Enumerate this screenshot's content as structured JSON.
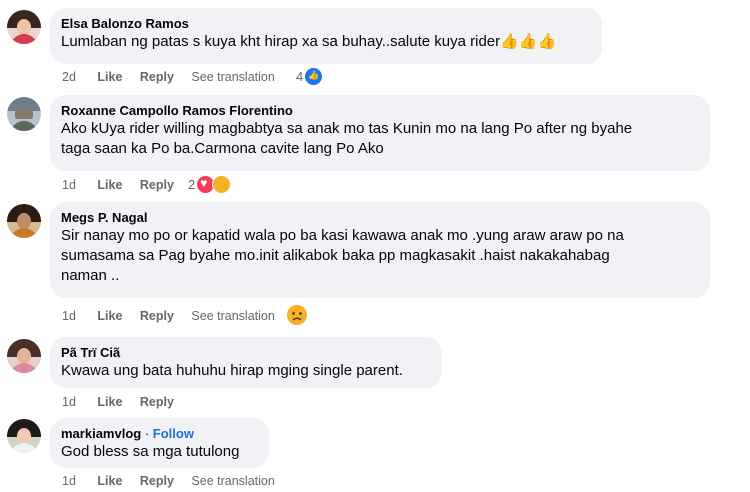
{
  "comments": [
    {
      "author": "Elsa Balonzo Ramos",
      "text_lines": [
        "Lumlaban ng patas s kuya kht hirap xa sa buhay..salute kuya rider"
      ],
      "emoji": "👍👍👍",
      "time": "2d",
      "like_label": "Like",
      "reply_label": "Reply",
      "translate_label": "See translation",
      "reaction_count": "4",
      "reactions": [
        "like-reaction-icon"
      ]
    },
    {
      "author": "Roxanne Campollo Ramos Florentino",
      "text_lines": [
        "Ako kUya rider willing magbabtya sa anak mo tas Kunin mo na lang Po after ng byahe",
        "taga saan ka Po ba.Carmona cavite lang Po Ako"
      ],
      "time": "1d",
      "like_label": "Like",
      "reply_label": "Reply",
      "reaction_count": "2",
      "reactions": [
        "love-reaction-icon",
        "care-reaction-icon"
      ]
    },
    {
      "author": "Megs P. Nagal",
      "text_lines": [
        "Sir nanay mo po or kapatid wala po ba kasi kawawa anak mo .yung araw araw po na",
        "sumasama sa Pag byahe mo.init alikabok baka pp magkasakit .haist nakakahabag",
        "naman .."
      ],
      "time": "1d",
      "like_label": "Like",
      "reply_label": "Reply",
      "translate_label": "See translation",
      "reactions": [
        "sad-reaction-icon"
      ]
    },
    {
      "author": "Pã Trï Ciã",
      "text_lines": [
        "Kwawa ung bata huhuhu hirap mging single parent."
      ],
      "time": "1d",
      "like_label": "Like",
      "reply_label": "Reply"
    },
    {
      "author": "markiamvlog",
      "follow_label": "Follow",
      "text_lines": [
        "God bless sa mga tutulong"
      ],
      "time": "1d",
      "like_label": "Like",
      "reply_label": "Reply",
      "translate_label": "See translation"
    }
  ],
  "colors": {
    "bubble": "#f0f2f5",
    "meta": "#65676b",
    "follow": "#216fdb",
    "like_reaction": "#1877f2",
    "love_reaction": "#f33e58",
    "haha_reaction": "#f7b125"
  }
}
